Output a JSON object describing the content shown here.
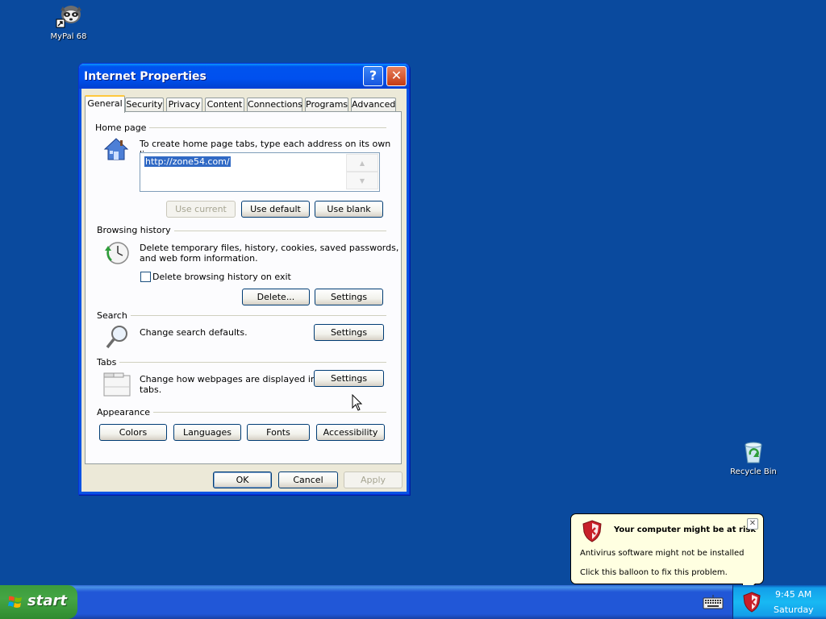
{
  "desktop": {
    "icons": [
      {
        "label": "MyPal 68",
        "icon": "raccoon-icon"
      },
      {
        "label": "Recycle Bin",
        "icon": "recycle-bin-icon"
      }
    ]
  },
  "window": {
    "title": "Internet Properties",
    "help_label": "?",
    "close_label": "✕",
    "tabs": [
      "General",
      "Security",
      "Privacy",
      "Content",
      "Connections",
      "Programs",
      "Advanced"
    ],
    "active_tab": "General",
    "home_page": {
      "group_label": "Home page",
      "instruction": "To create home page tabs, type each address on its own line.",
      "address": "http://zone54.com/",
      "use_current": "Use current",
      "use_default": "Use default",
      "use_blank": "Use blank"
    },
    "browsing_history": {
      "group_label": "Browsing history",
      "description_line1": "Delete temporary files, history, cookies, saved passwords,",
      "description_line2": "and web form information.",
      "checkbox_label": "Delete browsing history on exit",
      "checkbox_checked": false,
      "delete_button": "Delete...",
      "settings_button": "Settings"
    },
    "search": {
      "group_label": "Search",
      "description": "Change search defaults.",
      "settings_button": "Settings"
    },
    "tabs_group": {
      "group_label": "Tabs",
      "description_line1": "Change how webpages are displayed in",
      "description_line2": "tabs.",
      "settings_button": "Settings"
    },
    "appearance": {
      "group_label": "Appearance",
      "colors": "Colors",
      "languages": "Languages",
      "fonts": "Fonts",
      "accessibility": "Accessibility"
    },
    "footer": {
      "ok": "OK",
      "cancel": "Cancel",
      "apply": "Apply"
    }
  },
  "balloon": {
    "title": "Your computer might be at risk",
    "line1": "Antivirus software might not be installed",
    "line2": "Click this balloon to fix this problem.",
    "close_label": "✕"
  },
  "taskbar": {
    "start_label": "start",
    "time": "9:45 AM",
    "day": "Saturday"
  },
  "colors": {
    "desktop": "#0a4a9e",
    "titlebar": "#0053ee",
    "taskbar": "#2157d7",
    "start": "#3c9c3c"
  }
}
